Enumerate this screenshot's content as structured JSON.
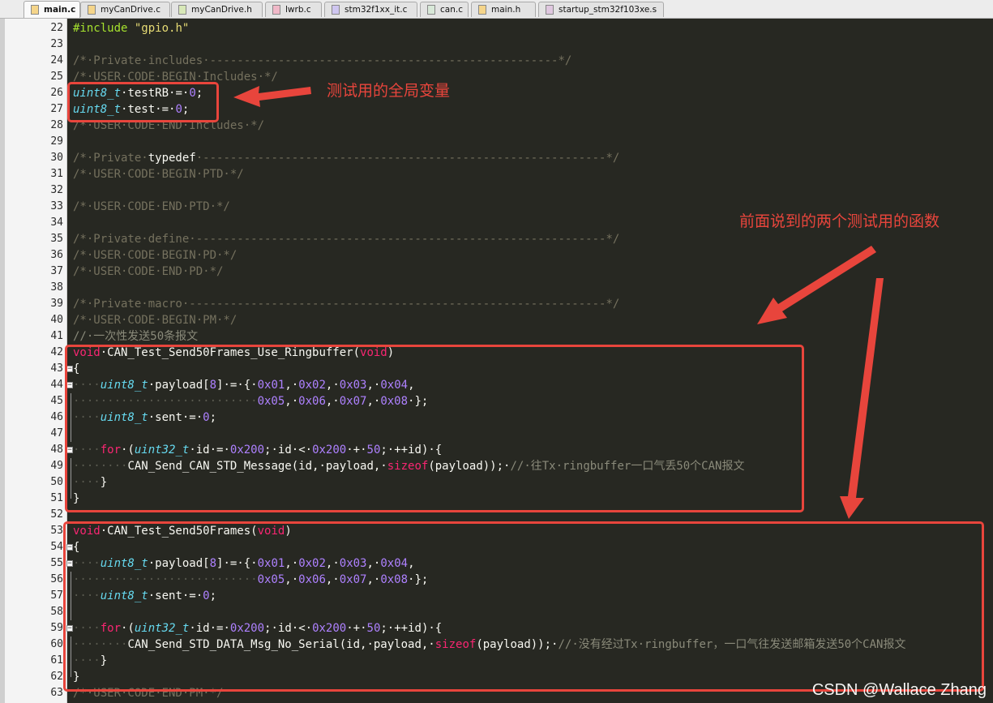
{
  "tabs": [
    {
      "label": "main.c",
      "active": true
    },
    {
      "label": "myCanDrive.c",
      "active": false
    },
    {
      "label": "myCanDrive.h",
      "active": false
    },
    {
      "label": "lwrb.c",
      "active": false
    },
    {
      "label": "stm32f1xx_it.c",
      "active": false
    },
    {
      "label": "can.c",
      "active": false
    },
    {
      "label": "main.h",
      "active": false
    },
    {
      "label": "startup_stm32f103xe.s",
      "active": false
    }
  ],
  "editor": {
    "lines": [
      {
        "n": "22",
        "segs": [
          [
            "pre",
            "#include"
          ],
          [
            "id",
            " "
          ],
          [
            "str",
            "\"gpio.h\""
          ]
        ]
      },
      {
        "n": "23",
        "segs": []
      },
      {
        "n": "24",
        "segs": [
          [
            "cmt",
            "/*·Private·includes·---------------------------------------------------*/"
          ]
        ]
      },
      {
        "n": "25",
        "segs": [
          [
            "cmt",
            "/*·USER·CODE·BEGIN·Includes·*/"
          ]
        ]
      },
      {
        "n": "26",
        "segs": [
          [
            "type",
            "uint8_t"
          ],
          [
            "id",
            "·testRB·=·"
          ],
          [
            "num",
            "0"
          ],
          [
            "id",
            ";"
          ]
        ]
      },
      {
        "n": "27",
        "segs": [
          [
            "type",
            "uint8_t"
          ],
          [
            "id",
            "·test·=·"
          ],
          [
            "num",
            "0"
          ],
          [
            "id",
            ";"
          ]
        ]
      },
      {
        "n": "28",
        "segs": [
          [
            "cmt",
            "/*·USER·CODE·END·Includes·*/"
          ]
        ]
      },
      {
        "n": "29",
        "segs": []
      },
      {
        "n": "30",
        "segs": [
          [
            "cmt",
            "/*·Private·"
          ],
          [
            "id",
            "typedef"
          ],
          [
            "cmt",
            "·-----------------------------------------------------------*/"
          ]
        ]
      },
      {
        "n": "31",
        "segs": [
          [
            "cmt",
            "/*·USER·CODE·BEGIN·PTD·*/"
          ]
        ]
      },
      {
        "n": "32",
        "segs": []
      },
      {
        "n": "33",
        "segs": [
          [
            "cmt",
            "/*·USER·CODE·END·PTD·*/"
          ]
        ]
      },
      {
        "n": "34",
        "segs": []
      },
      {
        "n": "35",
        "segs": [
          [
            "cmt",
            "/*·Private·define·------------------------------------------------------------*/"
          ]
        ]
      },
      {
        "n": "36",
        "segs": [
          [
            "cmt",
            "/*·USER·CODE·BEGIN·PD·*/"
          ]
        ]
      },
      {
        "n": "37",
        "segs": [
          [
            "cmt",
            "/*·USER·CODE·END·PD·*/"
          ]
        ]
      },
      {
        "n": "38",
        "segs": []
      },
      {
        "n": "39",
        "segs": [
          [
            "cmt",
            "/*·Private·macro·-------------------------------------------------------------*/"
          ]
        ]
      },
      {
        "n": "40",
        "segs": [
          [
            "cmt",
            "/*·USER·CODE·BEGIN·PM·*/"
          ]
        ]
      },
      {
        "n": "41",
        "segs": [
          [
            "cmt2",
            "//·一次性发送50条报文"
          ]
        ]
      },
      {
        "n": "42",
        "segs": [
          [
            "kw",
            "void"
          ],
          [
            "id",
            "·CAN_Test_Send50Frames_Use_Ringbuffer("
          ],
          [
            "kw",
            "void"
          ],
          [
            "id",
            ")"
          ]
        ]
      },
      {
        "n": "43",
        "segs": [
          [
            "id",
            "{"
          ]
        ]
      },
      {
        "n": "44",
        "segs": [
          [
            "ws",
            "····"
          ],
          [
            "type",
            "uint8_t"
          ],
          [
            "id",
            "·payload["
          ],
          [
            "num",
            "8"
          ],
          [
            "id",
            "]·=·{·"
          ],
          [
            "num",
            "0x01"
          ],
          [
            "id",
            ",·"
          ],
          [
            "num",
            "0x02"
          ],
          [
            "id",
            ",·"
          ],
          [
            "num",
            "0x03"
          ],
          [
            "id",
            ",·"
          ],
          [
            "num",
            "0x04"
          ],
          [
            "id",
            ","
          ]
        ]
      },
      {
        "n": "45",
        "segs": [
          [
            "ws",
            "···························"
          ],
          [
            "num",
            "0x05"
          ],
          [
            "id",
            ",·"
          ],
          [
            "num",
            "0x06"
          ],
          [
            "id",
            ",·"
          ],
          [
            "num",
            "0x07"
          ],
          [
            "id",
            ",·"
          ],
          [
            "num",
            "0x08"
          ],
          [
            "id",
            "·};"
          ]
        ]
      },
      {
        "n": "46",
        "segs": [
          [
            "ws",
            "····"
          ],
          [
            "type",
            "uint8_t"
          ],
          [
            "id",
            "·sent·=·"
          ],
          [
            "num",
            "0"
          ],
          [
            "id",
            ";"
          ]
        ]
      },
      {
        "n": "47",
        "segs": []
      },
      {
        "n": "48",
        "segs": [
          [
            "ws",
            "····"
          ],
          [
            "kw",
            "for"
          ],
          [
            "id",
            "·("
          ],
          [
            "type",
            "uint32_t"
          ],
          [
            "id",
            "·id·=·"
          ],
          [
            "num",
            "0x200"
          ],
          [
            "id",
            ";·id·<·"
          ],
          [
            "num",
            "0x200"
          ],
          [
            "id",
            "·+·"
          ],
          [
            "num",
            "50"
          ],
          [
            "id",
            ";·++id)·{"
          ]
        ]
      },
      {
        "n": "49",
        "segs": [
          [
            "ws",
            "········"
          ],
          [
            "id",
            "CAN_Send_CAN_STD_Message(id,·payload,·"
          ],
          [
            "kw",
            "sizeof"
          ],
          [
            "id",
            "(payload));·"
          ],
          [
            "cmt2",
            "//·往Tx·ringbuffer一口气丢50个CAN报文"
          ]
        ]
      },
      {
        "n": "50",
        "segs": [
          [
            "ws",
            "····"
          ],
          [
            "id",
            "}"
          ]
        ]
      },
      {
        "n": "51",
        "segs": [
          [
            "id",
            "}"
          ]
        ]
      },
      {
        "n": "52",
        "segs": []
      },
      {
        "n": "53",
        "segs": [
          [
            "kw",
            "void"
          ],
          [
            "id",
            "·CAN_Test_Send50Frames("
          ],
          [
            "kw",
            "void"
          ],
          [
            "id",
            ")"
          ]
        ]
      },
      {
        "n": "54",
        "segs": [
          [
            "id",
            "{"
          ]
        ]
      },
      {
        "n": "55",
        "segs": [
          [
            "ws",
            "····"
          ],
          [
            "type",
            "uint8_t"
          ],
          [
            "id",
            "·payload["
          ],
          [
            "num",
            "8"
          ],
          [
            "id",
            "]·=·{·"
          ],
          [
            "num",
            "0x01"
          ],
          [
            "id",
            ",·"
          ],
          [
            "num",
            "0x02"
          ],
          [
            "id",
            ",·"
          ],
          [
            "num",
            "0x03"
          ],
          [
            "id",
            ",·"
          ],
          [
            "num",
            "0x04"
          ],
          [
            "id",
            ","
          ]
        ]
      },
      {
        "n": "56",
        "segs": [
          [
            "ws",
            "···························"
          ],
          [
            "num",
            "0x05"
          ],
          [
            "id",
            ",·"
          ],
          [
            "num",
            "0x06"
          ],
          [
            "id",
            ",·"
          ],
          [
            "num",
            "0x07"
          ],
          [
            "id",
            ",·"
          ],
          [
            "num",
            "0x08"
          ],
          [
            "id",
            "·};"
          ]
        ]
      },
      {
        "n": "57",
        "segs": [
          [
            "ws",
            "····"
          ],
          [
            "type",
            "uint8_t"
          ],
          [
            "id",
            "·sent·=·"
          ],
          [
            "num",
            "0"
          ],
          [
            "id",
            ";"
          ]
        ]
      },
      {
        "n": "58",
        "segs": []
      },
      {
        "n": "59",
        "segs": [
          [
            "ws",
            "····"
          ],
          [
            "kw",
            "for"
          ],
          [
            "id",
            "·("
          ],
          [
            "type",
            "uint32_t"
          ],
          [
            "id",
            "·id·=·"
          ],
          [
            "num",
            "0x200"
          ],
          [
            "id",
            ";·id·<·"
          ],
          [
            "num",
            "0x200"
          ],
          [
            "id",
            "·+·"
          ],
          [
            "num",
            "50"
          ],
          [
            "id",
            ";·++id)·{"
          ]
        ]
      },
      {
        "n": "60",
        "segs": [
          [
            "ws",
            "········"
          ],
          [
            "id",
            "CAN_Send_STD_DATA_Msg_No_Serial(id,·payload,·"
          ],
          [
            "kw",
            "sizeof"
          ],
          [
            "id",
            "(payload));·"
          ],
          [
            "cmt2",
            "//·没有经过Tx·ringbuffer，一口气往发送邮箱发送50个CAN报文"
          ]
        ]
      },
      {
        "n": "61",
        "segs": [
          [
            "ws",
            "····"
          ],
          [
            "id",
            "}"
          ]
        ]
      },
      {
        "n": "62",
        "segs": [
          [
            "id",
            "}"
          ]
        ]
      },
      {
        "n": "63",
        "segs": [
          [
            "cmt",
            "/*·USER·CODE·END·PM·*/"
          ]
        ]
      }
    ]
  },
  "annotations": {
    "note_globals": "测试用的全局变量",
    "note_functions": "前面说到的两个测试用的函数",
    "color": "#e8453c"
  },
  "watermark": "CSDN @Wallace Zhang"
}
